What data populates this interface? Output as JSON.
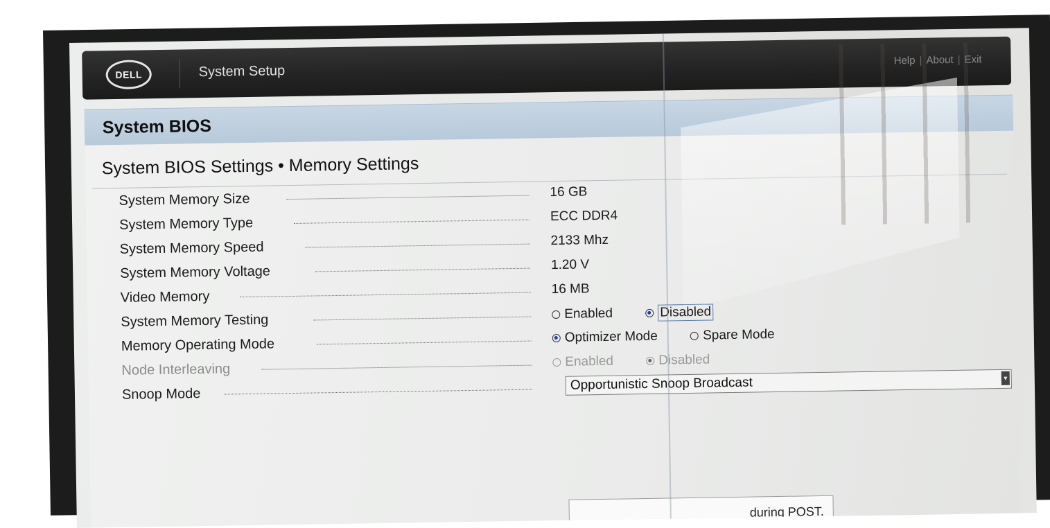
{
  "header": {
    "logo_text": "DELL",
    "title": "System Setup",
    "links": [
      "Help",
      "About",
      "Exit"
    ]
  },
  "panel": {
    "title": "System BIOS",
    "subtitle": "System BIOS Settings • Memory Settings"
  },
  "settings": [
    {
      "label": "System Memory Size",
      "value": "16 GB"
    },
    {
      "label": "System Memory Type",
      "value": "ECC DDR4"
    },
    {
      "label": "System Memory Speed",
      "value": "2133 Mhz"
    },
    {
      "label": "System Memory Voltage",
      "value": "1.20 V"
    },
    {
      "label": "Video Memory",
      "value": "16 MB"
    },
    {
      "label": "System Memory Testing",
      "options": [
        "Enabled",
        "Disabled"
      ],
      "selected": "Disabled"
    },
    {
      "label": "Memory Operating Mode",
      "options": [
        "Optimizer Mode",
        "Spare Mode"
      ],
      "selected": "Optimizer Mode"
    },
    {
      "label": "Node Interleaving",
      "options": [
        "Enabled",
        "Disabled"
      ],
      "selected": "Disabled",
      "disabled": true
    },
    {
      "label": "Snoop Mode",
      "dropdown_value": "Opportunistic Snoop Broadcast"
    }
  ],
  "help_box": {
    "text": "during POST."
  }
}
